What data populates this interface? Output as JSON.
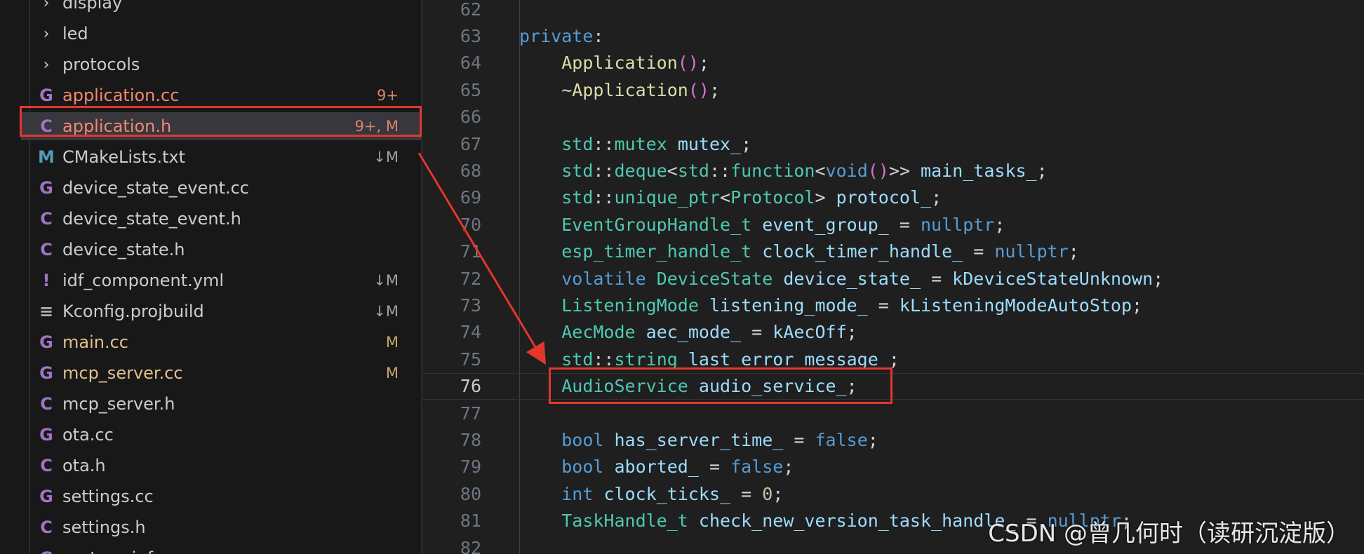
{
  "explorer": {
    "items": [
      {
        "kind": "folder",
        "name": "display",
        "icon": "chevron-right-icon",
        "glyph": "›",
        "badge": "",
        "status": "default"
      },
      {
        "kind": "folder",
        "name": "led",
        "icon": "chevron-right-icon",
        "glyph": "›",
        "badge": "",
        "status": "default"
      },
      {
        "kind": "folder",
        "name": "protocols",
        "icon": "chevron-right-icon",
        "glyph": "›",
        "badge": "",
        "status": "default"
      },
      {
        "kind": "file",
        "name": "application.cc",
        "icon": "cpp-file-icon",
        "glyph": "G",
        "badge": "9+",
        "status": "error"
      },
      {
        "kind": "file",
        "name": "application.h",
        "icon": "c-header-file-icon",
        "glyph": "C",
        "badge": "9+, M",
        "status": "error",
        "selected": true
      },
      {
        "kind": "file",
        "name": "CMakeLists.txt",
        "icon": "cmake-file-icon",
        "glyph": "M",
        "badge": "↓M",
        "status": "default"
      },
      {
        "kind": "file",
        "name": "device_state_event.cc",
        "icon": "cpp-file-icon",
        "glyph": "G",
        "badge": "",
        "status": "default"
      },
      {
        "kind": "file",
        "name": "device_state_event.h",
        "icon": "c-header-file-icon",
        "glyph": "C",
        "badge": "",
        "status": "default"
      },
      {
        "kind": "file",
        "name": "device_state.h",
        "icon": "c-header-file-icon",
        "glyph": "C",
        "badge": "",
        "status": "default"
      },
      {
        "kind": "file",
        "name": "idf_component.yml",
        "icon": "yaml-file-icon",
        "glyph": "!",
        "badge": "↓M",
        "status": "default"
      },
      {
        "kind": "file",
        "name": "Kconfig.projbuild",
        "icon": "text-file-icon",
        "glyph": "≡",
        "badge": "↓M",
        "status": "default"
      },
      {
        "kind": "file",
        "name": "main.cc",
        "icon": "cpp-file-icon",
        "glyph": "G",
        "badge": "M",
        "status": "modified"
      },
      {
        "kind": "file",
        "name": "mcp_server.cc",
        "icon": "cpp-file-icon",
        "glyph": "G",
        "badge": "M",
        "status": "modified"
      },
      {
        "kind": "file",
        "name": "mcp_server.h",
        "icon": "c-header-file-icon",
        "glyph": "C",
        "badge": "",
        "status": "default"
      },
      {
        "kind": "file",
        "name": "ota.cc",
        "icon": "cpp-file-icon",
        "glyph": "G",
        "badge": "",
        "status": "default"
      },
      {
        "kind": "file",
        "name": "ota.h",
        "icon": "c-header-file-icon",
        "glyph": "C",
        "badge": "",
        "status": "default"
      },
      {
        "kind": "file",
        "name": "settings.cc",
        "icon": "cpp-file-icon",
        "glyph": "G",
        "badge": "",
        "status": "default"
      },
      {
        "kind": "file",
        "name": "settings.h",
        "icon": "c-header-file-icon",
        "glyph": "C",
        "badge": "",
        "status": "default"
      },
      {
        "kind": "file",
        "name": "system_info.cc",
        "icon": "cpp-file-icon",
        "glyph": "G",
        "badge": "",
        "status": "default"
      }
    ]
  },
  "editor": {
    "current_line": "76",
    "lines": [
      {
        "n": "62",
        "tokens": []
      },
      {
        "n": "63",
        "tokens": [
          [
            "kw",
            "private"
          ],
          [
            "plain",
            ":"
          ]
        ]
      },
      {
        "n": "64",
        "tokens": [
          [
            "plain",
            "    "
          ],
          [
            "fn",
            "Application"
          ],
          [
            "paren",
            "()"
          ],
          [
            "plain",
            ";"
          ]
        ]
      },
      {
        "n": "65",
        "tokens": [
          [
            "plain",
            "    ~"
          ],
          [
            "fn",
            "Application"
          ],
          [
            "paren",
            "()"
          ],
          [
            "plain",
            ";"
          ]
        ]
      },
      {
        "n": "66",
        "tokens": []
      },
      {
        "n": "67",
        "tokens": [
          [
            "plain",
            "    "
          ],
          [
            "type",
            "std"
          ],
          [
            "plain",
            "::"
          ],
          [
            "type",
            "mutex"
          ],
          [
            "plain",
            " "
          ],
          [
            "var",
            "mutex_"
          ],
          [
            "plain",
            ";"
          ]
        ]
      },
      {
        "n": "68",
        "tokens": [
          [
            "plain",
            "    "
          ],
          [
            "type",
            "std"
          ],
          [
            "plain",
            "::"
          ],
          [
            "type",
            "deque"
          ],
          [
            "plain",
            "<"
          ],
          [
            "type",
            "std"
          ],
          [
            "plain",
            "::"
          ],
          [
            "type",
            "function"
          ],
          [
            "plain",
            "<"
          ],
          [
            "kw",
            "void"
          ],
          [
            "paren",
            "()"
          ],
          [
            "plain",
            ">> "
          ],
          [
            "var",
            "main_tasks_"
          ],
          [
            "plain",
            ";"
          ]
        ]
      },
      {
        "n": "69",
        "tokens": [
          [
            "plain",
            "    "
          ],
          [
            "type",
            "std"
          ],
          [
            "plain",
            "::"
          ],
          [
            "type",
            "unique_ptr"
          ],
          [
            "plain",
            "<"
          ],
          [
            "type",
            "Protocol"
          ],
          [
            "plain",
            "> "
          ],
          [
            "var",
            "protocol_"
          ],
          [
            "plain",
            ";"
          ]
        ]
      },
      {
        "n": "70",
        "tokens": [
          [
            "plain",
            "    "
          ],
          [
            "type",
            "EventGroupHandle_t"
          ],
          [
            "plain",
            " "
          ],
          [
            "var",
            "event_group_"
          ],
          [
            "plain",
            " = "
          ],
          [
            "kw",
            "nullptr"
          ],
          [
            "plain",
            ";"
          ]
        ]
      },
      {
        "n": "71",
        "tokens": [
          [
            "plain",
            "    "
          ],
          [
            "type",
            "esp_timer_handle_t"
          ],
          [
            "plain",
            " "
          ],
          [
            "var",
            "clock_timer_handle_"
          ],
          [
            "plain",
            " = "
          ],
          [
            "kw",
            "nullptr"
          ],
          [
            "plain",
            ";"
          ]
        ]
      },
      {
        "n": "72",
        "tokens": [
          [
            "plain",
            "    "
          ],
          [
            "kw",
            "volatile"
          ],
          [
            "plain",
            " "
          ],
          [
            "type",
            "DeviceState"
          ],
          [
            "plain",
            " "
          ],
          [
            "var",
            "device_state_"
          ],
          [
            "plain",
            " = "
          ],
          [
            "var",
            "kDeviceStateUnknown"
          ],
          [
            "plain",
            ";"
          ]
        ]
      },
      {
        "n": "73",
        "tokens": [
          [
            "plain",
            "    "
          ],
          [
            "type",
            "ListeningMode"
          ],
          [
            "plain",
            " "
          ],
          [
            "var",
            "listening_mode_"
          ],
          [
            "plain",
            " = "
          ],
          [
            "var",
            "kListeningModeAutoStop"
          ],
          [
            "plain",
            ";"
          ]
        ]
      },
      {
        "n": "74",
        "tokens": [
          [
            "plain",
            "    "
          ],
          [
            "type",
            "AecMode"
          ],
          [
            "plain",
            " "
          ],
          [
            "var",
            "aec_mode_"
          ],
          [
            "plain",
            " = "
          ],
          [
            "var",
            "kAecOff"
          ],
          [
            "plain",
            ";"
          ]
        ]
      },
      {
        "n": "75",
        "tokens": [
          [
            "plain",
            "    "
          ],
          [
            "type",
            "std"
          ],
          [
            "plain",
            "::"
          ],
          [
            "type",
            "string"
          ],
          [
            "plain",
            " "
          ],
          [
            "var",
            "last_error_message_"
          ],
          [
            "plain",
            ";"
          ]
        ]
      },
      {
        "n": "76",
        "tokens": [
          [
            "plain",
            "    "
          ],
          [
            "type",
            "AudioService"
          ],
          [
            "plain",
            " "
          ],
          [
            "var",
            "audio_service_"
          ],
          [
            "plain",
            ";"
          ]
        ]
      },
      {
        "n": "77",
        "tokens": []
      },
      {
        "n": "78",
        "tokens": [
          [
            "plain",
            "    "
          ],
          [
            "kw",
            "bool"
          ],
          [
            "plain",
            " "
          ],
          [
            "var",
            "has_server_time_"
          ],
          [
            "plain",
            " = "
          ],
          [
            "kw",
            "false"
          ],
          [
            "plain",
            ";"
          ]
        ]
      },
      {
        "n": "79",
        "tokens": [
          [
            "plain",
            "    "
          ],
          [
            "kw",
            "bool"
          ],
          [
            "plain",
            " "
          ],
          [
            "var",
            "aborted_"
          ],
          [
            "plain",
            " = "
          ],
          [
            "kw",
            "false"
          ],
          [
            "plain",
            ";"
          ]
        ]
      },
      {
        "n": "80",
        "tokens": [
          [
            "plain",
            "    "
          ],
          [
            "kw",
            "int"
          ],
          [
            "plain",
            " "
          ],
          [
            "var",
            "clock_ticks_"
          ],
          [
            "plain",
            " = "
          ],
          [
            "num",
            "0"
          ],
          [
            "plain",
            ";"
          ]
        ]
      },
      {
        "n": "81",
        "tokens": [
          [
            "plain",
            "    "
          ],
          [
            "type",
            "TaskHandle_t"
          ],
          [
            "plain",
            " "
          ],
          [
            "var",
            "check_new_version_task_handle_"
          ],
          [
            "plain",
            " = "
          ],
          [
            "kw",
            "nullptr"
          ],
          [
            "plain",
            ";"
          ]
        ]
      },
      {
        "n": "82",
        "tokens": []
      }
    ]
  },
  "annotation": {
    "color": "#e1372c"
  },
  "watermark": "CSDN @曾几何时（读研沉淀版）"
}
